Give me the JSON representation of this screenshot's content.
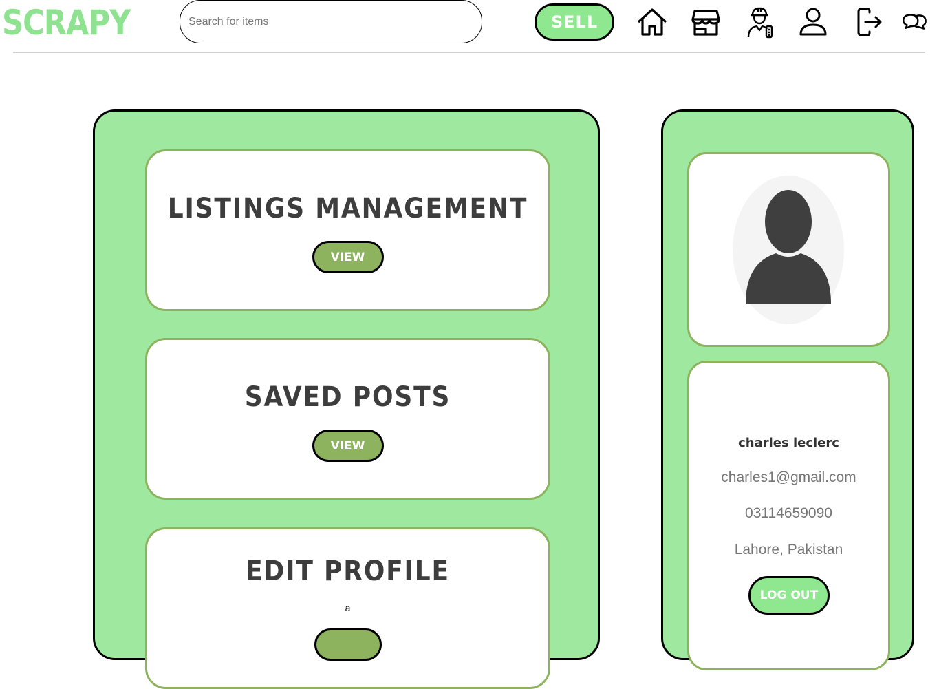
{
  "header": {
    "logo": "SCRAPY",
    "search_placeholder": "Search for items",
    "sell_label": "SELL",
    "nav_icons": [
      "home-icon",
      "store-icon",
      "worker-icon",
      "user-icon",
      "logout-icon",
      "chat-icon"
    ]
  },
  "cards": [
    {
      "title": "LISTINGS MANAGEMENT",
      "button": "VIEW"
    },
    {
      "title": "SAVED POSTS",
      "button": "VIEW"
    },
    {
      "title": "EDIT PROFILE",
      "subtitle": "a"
    }
  ],
  "profile": {
    "name": "charles leclerc",
    "email": "charles1@gmail.com",
    "phone": "03114659090",
    "location": "Lahore, Pakistan",
    "logout_label": "LOG OUT"
  },
  "colors": {
    "brand_green": "#8fe28f",
    "panel_green": "#9fe89f",
    "button_olive": "#8db35e"
  }
}
